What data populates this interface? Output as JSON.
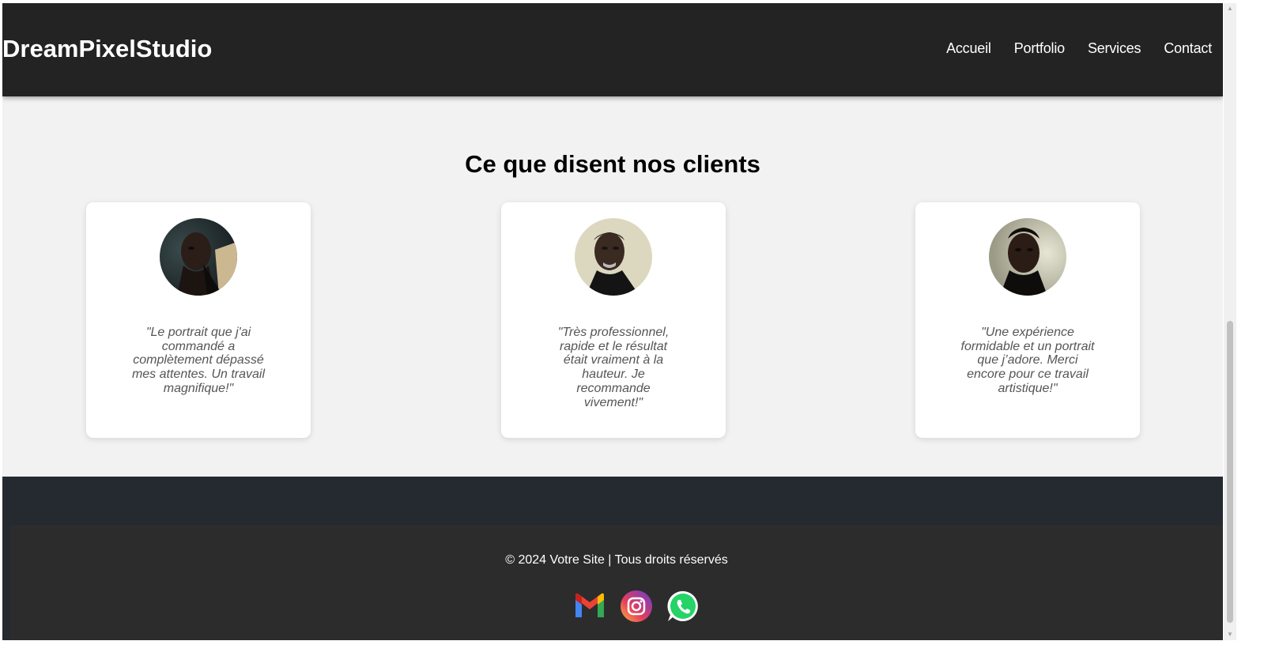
{
  "header": {
    "brand": "DreamPixelStudio",
    "nav": [
      {
        "label": "Accueil"
      },
      {
        "label": "Portfolio"
      },
      {
        "label": "Services"
      },
      {
        "label": "Contact"
      }
    ]
  },
  "testimonials": {
    "title": "Ce que disent nos clients",
    "items": [
      {
        "quote": "\"Le portrait que j'ai commandé a complètement dépassé mes attentes. Un travail magnifique!\"",
        "avatar": "client-portrait-photo"
      },
      {
        "quote": "\"Très professionnel, rapide et le résultat était vraiment à la hauteur. Je recommande vivement!\"",
        "avatar": "client-portrait-photo"
      },
      {
        "quote": "\"Une expérience formidable et un portrait que j’adore. Merci encore pour ce travail artistique!\"",
        "avatar": "client-portrait-photo"
      }
    ]
  },
  "footer": {
    "copyright": "© 2024 Votre Site | Tous droits réservés",
    "socials": [
      {
        "icon": "gmail-icon"
      },
      {
        "icon": "instagram-icon"
      },
      {
        "icon": "whatsapp-icon"
      }
    ]
  },
  "colors": {
    "header_bg": "#232323",
    "page_bg": "#f2f2f2",
    "footer_band": "#252a30",
    "footer_bg": "#2c2c2c",
    "quote_text": "#555555"
  }
}
